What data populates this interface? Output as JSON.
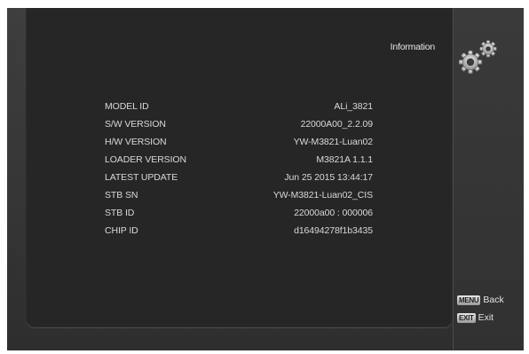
{
  "header": {
    "title": "Information",
    "icon": "gears-icon"
  },
  "info": {
    "rows": [
      {
        "label": "MODEL ID",
        "value": "ALi_3821"
      },
      {
        "label": "S/W VERSION",
        "value": "22000A00_2.2.09"
      },
      {
        "label": "H/W VERSION",
        "value": "YW-M3821-Luan02"
      },
      {
        "label": "LOADER VERSION",
        "value": "M3821A 1.1.1"
      },
      {
        "label": "LATEST UPDATE",
        "value": "Jun 25 2015 13:44:17"
      },
      {
        "label": "STB SN",
        "value": "YW-M3821-Luan02_CIS"
      },
      {
        "label": "STB ID",
        "value": "22000a00 : 000006"
      },
      {
        "label": "CHIP ID",
        "value": "d16494278f1b3435"
      }
    ]
  },
  "hints": {
    "back": {
      "key": "MENU",
      "label": "Back"
    },
    "exit": {
      "key": "EXIT",
      "label": "Exit"
    }
  },
  "colors": {
    "panel": "#262626",
    "background": "#363636",
    "text": "#d9d9d9"
  }
}
